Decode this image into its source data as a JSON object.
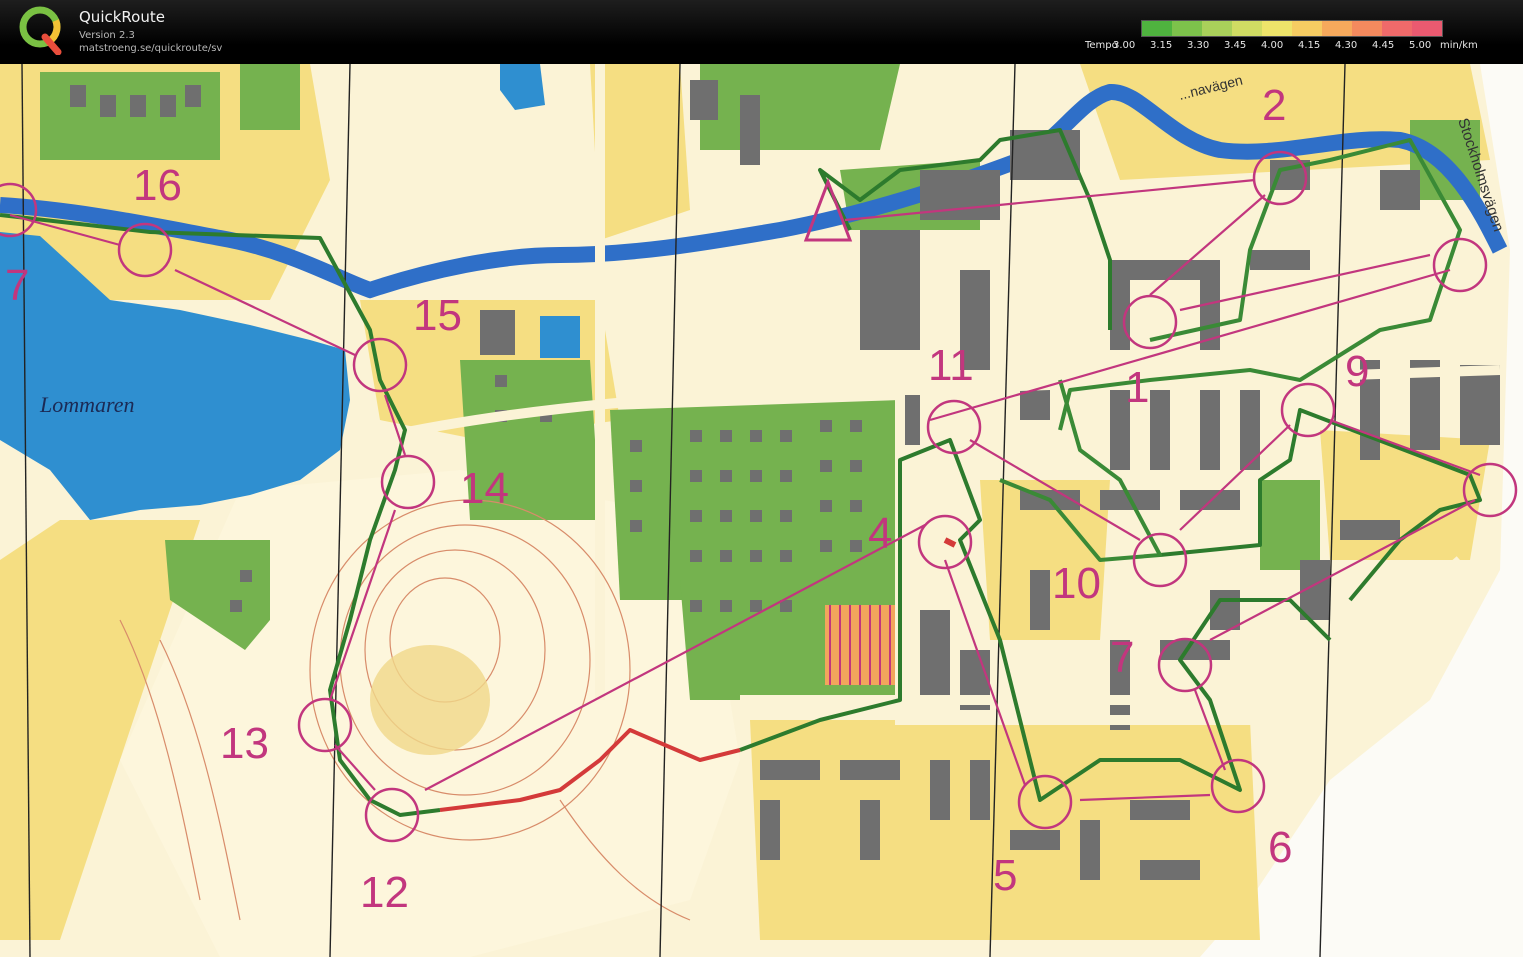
{
  "app": {
    "title": "QuickRoute",
    "version": "Version 2.3",
    "url": "matstroeng.se/quickroute/sv",
    "logo_letter": "Q"
  },
  "legend": {
    "caption": "Tempo",
    "ticks": [
      "3.00",
      "3.15",
      "3.30",
      "3.45",
      "4.00",
      "4.15",
      "4.30",
      "4.45",
      "5.00"
    ],
    "unit": "min/km",
    "colors": [
      "#4fb33f",
      "#7dc24b",
      "#a9d05a",
      "#d0dc63",
      "#eee46a",
      "#f6cc62",
      "#f6a95c",
      "#f48a5e",
      "#ef6a6a",
      "#ea5a70"
    ]
  },
  "map": {
    "lake_name": "Lommaren",
    "street_1": "Stockholmsvägen",
    "street_2": "...navägen",
    "controls": [
      "1",
      "2",
      "4",
      "5",
      "6",
      "7",
      "9",
      "10",
      "11",
      "12",
      "13",
      "14",
      "15",
      "16",
      "7"
    ],
    "colors": {
      "lake": "#2f8fd0",
      "river": "#2f6fc8",
      "open_land": "#f5de82",
      "rough_open": "#f8ecb8",
      "green": "#75b24f",
      "building": "#6f6f6f",
      "course": "#c2367e",
      "route_slow": "#d43a3a",
      "route_fast": "#2d7b2d"
    }
  }
}
